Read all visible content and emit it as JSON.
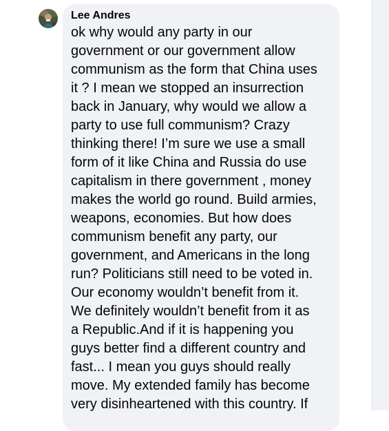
{
  "comment": {
    "author": "Lee Andres",
    "avatar_icon": "user-avatar-photo",
    "text_lines": [
      "ok why would any party in our",
      "government or our government allow",
      "communism as the form that China uses",
      "it ? I mean we stopped an insurrection",
      "back in January, why would we allow a",
      "party to use full communism? Crazy",
      "thinking there! I’m sure we use a small",
      "form of it like China and Russia do use",
      "capitalism in there government , money",
      "makes the world go round. Build armies,",
      "weapons, economies. But how does",
      "communism benefit any party, our",
      "government, and Americans in the long",
      "run? Politicians still need to be voted in.",
      "Our economy wouldn’t benefit from it.",
      "We definitely wouldn’t benefit from it as",
      "a Republic.And if it is happening you",
      "guys better find a different country and",
      "fast... I mean you guys should really",
      "move. My extended family has become",
      "very disinheartened with this country. If"
    ]
  },
  "colors": {
    "bubble_background": "#f0f2f5",
    "text": "#050505",
    "page_background": "#ffffff",
    "rail_background": "#f0f2f5"
  }
}
